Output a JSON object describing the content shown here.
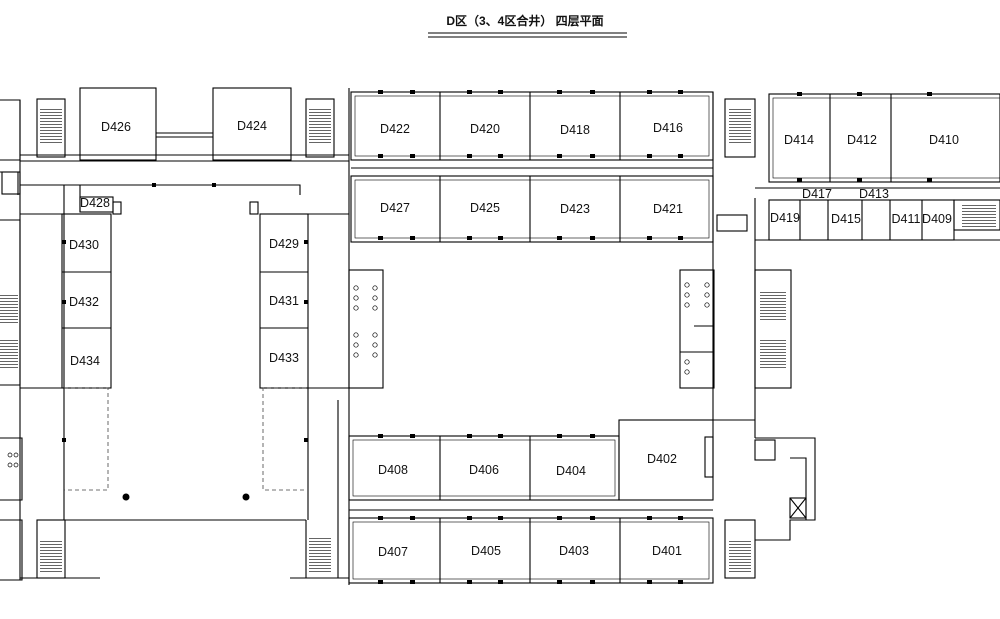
{
  "title": "D区（3、4区合井） 四层平面",
  "rooms": {
    "D401": "D401",
    "D402": "D402",
    "D403": "D403",
    "D404": "D404",
    "D405": "D405",
    "D406": "D406",
    "D407": "D407",
    "D408": "D408",
    "D409": "D409",
    "D410": "D410",
    "D411": "D411",
    "D412": "D412",
    "D413": "D413",
    "D414": "D414",
    "D415": "D415",
    "D416": "D416",
    "D417": "D417",
    "D418": "D418",
    "D419": "D419",
    "D420": "D420",
    "D421": "D421",
    "D422": "D422",
    "D423": "D423",
    "D424": "D424",
    "D425": "D425",
    "D426": "D426",
    "D427": "D427",
    "D428": "D428",
    "D429": "D429",
    "D430": "D430",
    "D431": "D431",
    "D432": "D432",
    "D433": "D433",
    "D434": "D434"
  }
}
